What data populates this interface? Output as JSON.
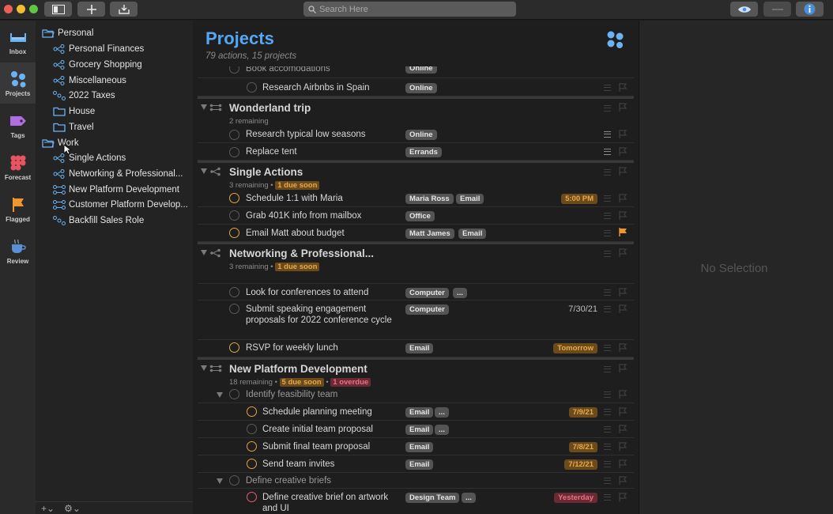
{
  "toolbar": {
    "search_placeholder": "Search Here",
    "buttons": [
      "sidebar-toggle",
      "new-item",
      "quick-entry",
      "perspective-view",
      "focus",
      "inspector-info"
    ]
  },
  "rail": [
    {
      "label": "Inbox",
      "icon": "tray-icon",
      "active": false
    },
    {
      "label": "Projects",
      "icon": "projects-icon",
      "active": true
    },
    {
      "label": "Tags",
      "icon": "tag-icon",
      "active": false
    },
    {
      "label": "Forecast",
      "icon": "calendar-grid-icon",
      "active": false
    },
    {
      "label": "Flagged",
      "icon": "flag-icon",
      "active": false
    },
    {
      "label": "Review",
      "icon": "coffee-cup-icon",
      "active": false
    }
  ],
  "sidebar": {
    "folders": [
      {
        "label": "Personal",
        "projects": [
          "Personal Finances",
          "Grocery Shopping",
          "Miscellaneous",
          "2022 Taxes"
        ]
      },
      {
        "label": "House"
      },
      {
        "label": "Travel"
      },
      {
        "label": "Work",
        "projects": [
          "Single Actions",
          "Networking & Professional...",
          "New Platform Development",
          "Customer Platform Develop...",
          "Backfill Sales Role"
        ]
      }
    ],
    "footer": {
      "add": "+",
      "gear": "⚙"
    }
  },
  "main": {
    "title": "Projects",
    "subtitle": "79 actions, 15 projects",
    "partial_row": {
      "title": "Book accomodations",
      "tag": "Online"
    },
    "row_airbnb": {
      "title": "Research Airbnbs in Spain",
      "tag": "Online"
    },
    "wonderland": {
      "title": "Wonderland trip",
      "meta": "2 remaining",
      "tasks": [
        {
          "title": "Research typical low seasons",
          "tag": "Online"
        },
        {
          "title": "Replace tent",
          "tag": "Errands"
        }
      ]
    },
    "single": {
      "title": "Single Actions",
      "meta": "3 remaining",
      "meta_sep": "•",
      "soon": "1 due soon",
      "tasks": [
        {
          "title": "Schedule 1:1 with Maria",
          "tags": [
            "Maria Ross",
            "Email"
          ],
          "due": "5:00 PM"
        },
        {
          "title": "Grab 401K info from mailbox",
          "tags": [
            "Office"
          ]
        },
        {
          "title": "Email Matt about budget",
          "tags": [
            "Matt James",
            "Email"
          ],
          "flagged": true
        }
      ]
    },
    "networking": {
      "title": "Networking & Professional...",
      "meta": "3 remaining",
      "meta_sep": "•",
      "soon": "1 due soon",
      "tasks": [
        {
          "title": "Look for conferences to attend",
          "tags": [
            "Computer",
            "..."
          ]
        },
        {
          "title": "Submit speaking engagement proposals for 2022 conference cycle",
          "tags": [
            "Computer"
          ],
          "date": "7/30/21"
        },
        {
          "title": "RSVP for weekly lunch",
          "tags": [
            "Email"
          ],
          "due": "Tomorrow"
        }
      ]
    },
    "platform": {
      "title": "New Platform Development",
      "meta": "18 remaining",
      "meta_sep": "•",
      "soon": "5 due soon",
      "overdue": "1 overdue",
      "groups": [
        {
          "title": "Identify feasibility team",
          "tasks": [
            {
              "title": "Schedule planning meeting",
              "tags": [
                "Email",
                "..."
              ],
              "due": "7/9/21"
            },
            {
              "title": "Create initial team proposal",
              "tags": [
                "Email",
                "..."
              ]
            },
            {
              "title": "Submit final team proposal",
              "tags": [
                "Email"
              ],
              "due": "7/8/21"
            },
            {
              "title": "Send team invites",
              "tags": [
                "Email"
              ],
              "due": "7/12/21"
            }
          ]
        },
        {
          "title": "Define creative briefs",
          "tasks": [
            {
              "title": "Define creative brief on artwork and UI",
              "tags": [
                "Design Team",
                "..."
              ],
              "due": "Yesterday"
            }
          ]
        }
      ]
    }
  },
  "inspector": {
    "empty_text": "No Selection"
  },
  "colors": {
    "accent": "#54a7f4",
    "due_soon": "#e8a849",
    "overdue": "#ec6f82",
    "flag": "#f0962c"
  }
}
